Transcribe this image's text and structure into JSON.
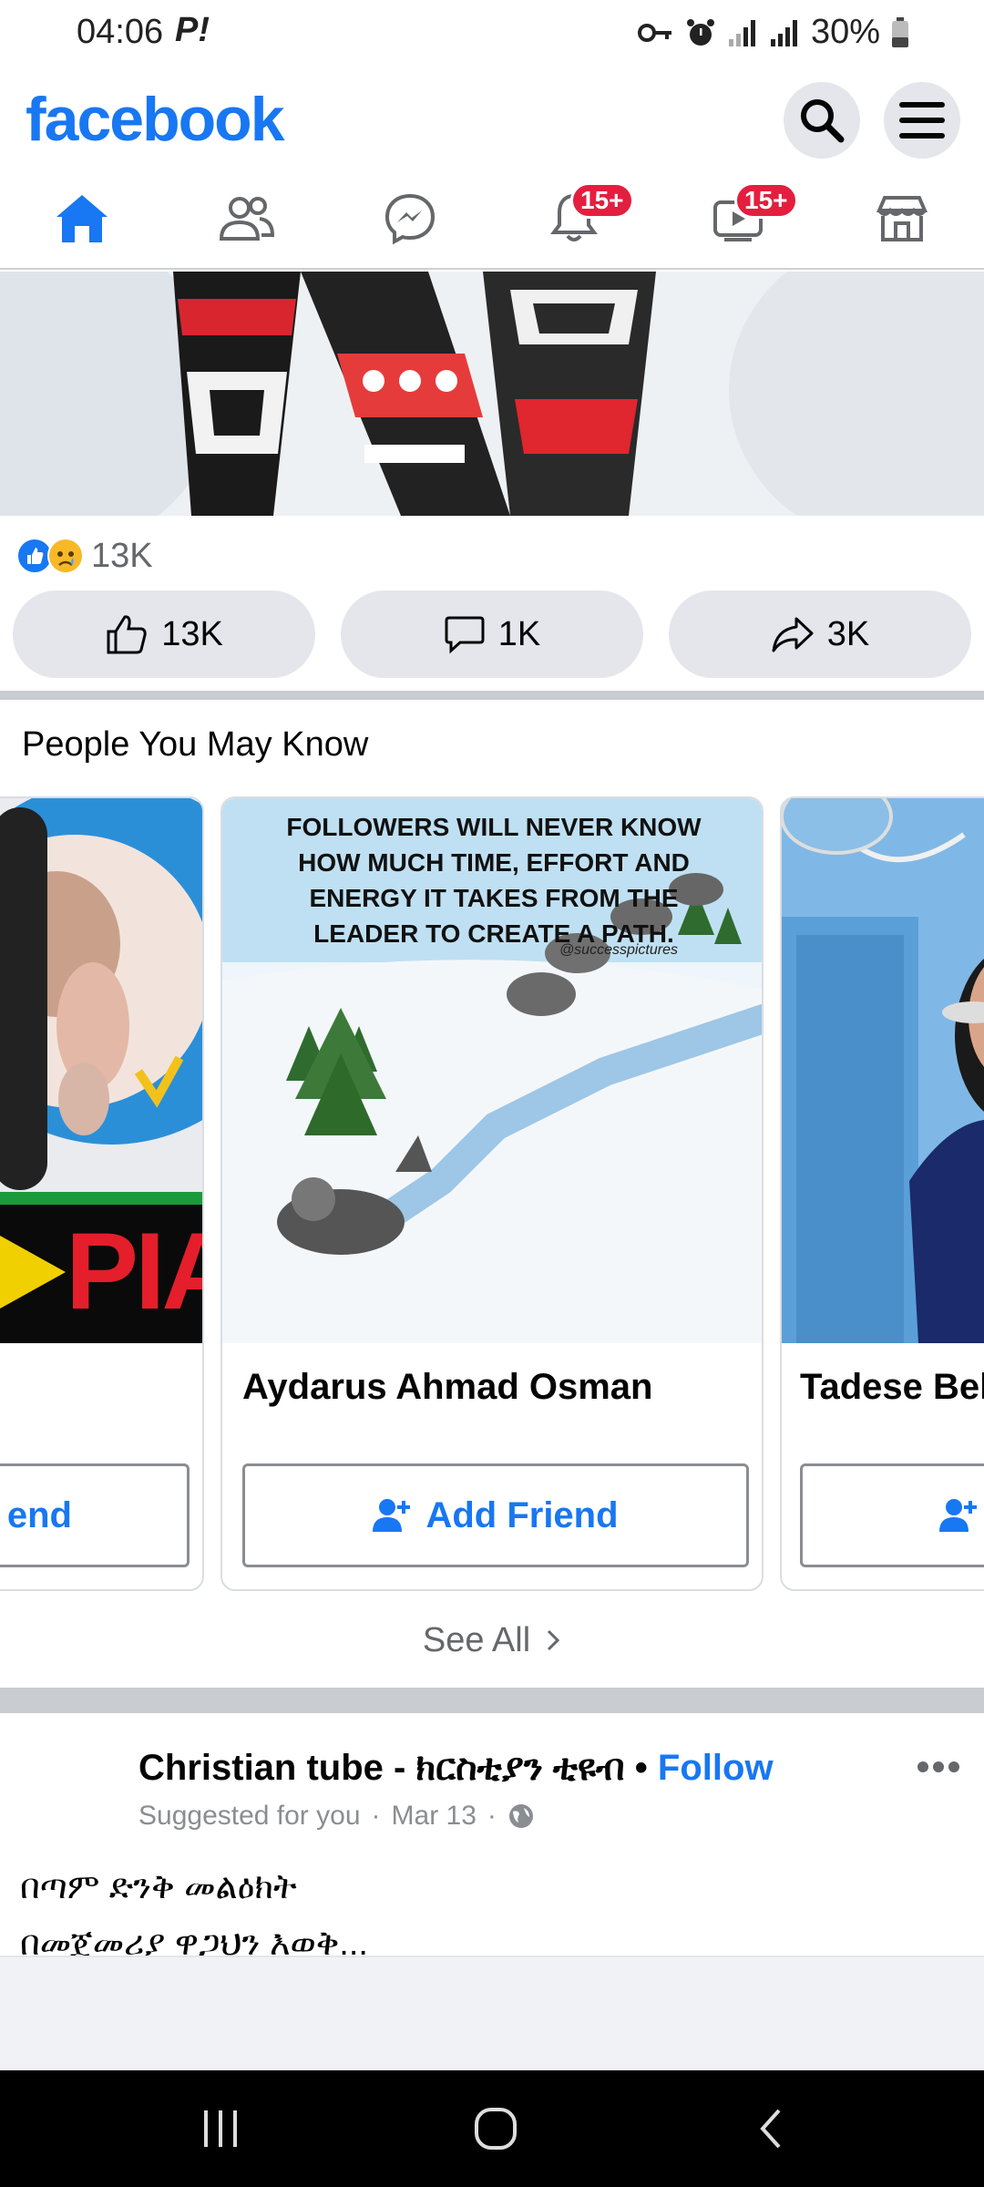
{
  "status_bar": {
    "time": "04:06",
    "p_indicator": "P!",
    "battery": "30%"
  },
  "header": {
    "logo": "facebook",
    "search_icon": "search-icon",
    "menu_icon": "hamburger-menu-icon"
  },
  "nav": {
    "tabs": [
      {
        "icon": "home-icon",
        "active": true
      },
      {
        "icon": "friends-icon"
      },
      {
        "icon": "messenger-icon"
      },
      {
        "icon": "notifications-bell-icon",
        "badge": "15+"
      },
      {
        "icon": "video-icon",
        "badge": "15+"
      },
      {
        "icon": "marketplace-icon"
      }
    ]
  },
  "post1": {
    "reaction_count": "13K",
    "actions": {
      "like": "13K",
      "comment": "1K",
      "share": "3K"
    }
  },
  "pymk": {
    "title": "People You May Know",
    "cards": [
      {
        "name": "",
        "button": "end",
        "image_text": "PIA"
      },
      {
        "name": "Aydarus Ahmad Osman",
        "button": "Add Friend",
        "image_caption": "FOLLOWERS WILL NEVER KNOW HOW MUCH TIME, EFFORT AND ENERGY IT TAKES FROM THE LEADER TO CREATE A PATH.",
        "image_credit": "@successpictures"
      },
      {
        "name": "Tadese Bel",
        "button": ""
      }
    ],
    "see_all": "See All"
  },
  "post2": {
    "page_name": "Christian tube - ክርስቲያን ቲዩብ",
    "bullet": "•",
    "follow": "Follow",
    "meta": "Suggested for you",
    "meta_sep": "·",
    "date": "Mar 13",
    "text_line1": "በጣም ድንቅ መልዕክት",
    "text_line2": "በመጀመሪያ ዋጋህን እወቅ..."
  },
  "colors": {
    "brand": "#1877f2",
    "badge": "#e41e3f",
    "pill": "#e4e6eb"
  }
}
